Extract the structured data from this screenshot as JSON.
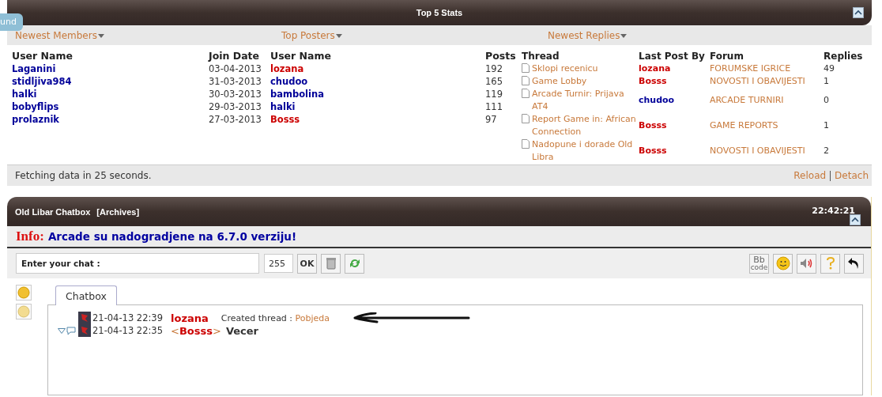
{
  "side_tab": "und",
  "stats": {
    "title": "Top 5 Stats",
    "tabs": [
      {
        "label": "Newest Members"
      },
      {
        "label": "Top Posters"
      },
      {
        "label": "Newest Replies"
      }
    ],
    "members": {
      "columns": [
        "User Name",
        "Join Date"
      ],
      "rows": [
        {
          "name": "Laganini",
          "date": "03-04-2013",
          "color": "#000099"
        },
        {
          "name": "stidljiva984",
          "date": "31-03-2013",
          "color": "#000099"
        },
        {
          "name": "halki",
          "date": "30-03-2013",
          "color": "#000099"
        },
        {
          "name": "bobyflips",
          "date": "29-03-2013",
          "color": "#000099"
        },
        {
          "name": "prolaznik",
          "date": "27-03-2013",
          "color": "#000099"
        }
      ]
    },
    "posters": {
      "columns": [
        "User Name",
        "Posts"
      ],
      "rows": [
        {
          "name": "lozana",
          "posts": "192",
          "color": "#cc0000"
        },
        {
          "name": "chudoo",
          "posts": "165",
          "color": "#000099"
        },
        {
          "name": "bambolina",
          "posts": "119",
          "color": "#000099"
        },
        {
          "name": "halki",
          "posts": "111",
          "color": "#000099"
        },
        {
          "name": "Bosss",
          "posts": "97",
          "color": "#cc0000"
        }
      ]
    },
    "replies": {
      "columns": [
        "Thread",
        "Last Post By",
        "Forum",
        "Replies"
      ],
      "rows": [
        {
          "thread": "Sklopi recenicu",
          "by": "lozana",
          "color": "#cc0000",
          "forum": "FORUMSKE IGRICE",
          "replies": "49"
        },
        {
          "thread": "Game Lobby",
          "by": "Bosss",
          "color": "#cc0000",
          "forum": "NOVOSTI I OBAVIJESTI",
          "replies": "1"
        },
        {
          "thread": "Arcade Turnir: Prijava AT4",
          "by": "chudoo",
          "color": "#000099",
          "forum": "ARCADE TURNIRI",
          "replies": "0"
        },
        {
          "thread": "Report Game in: African Connection",
          "by": "Bosss",
          "color": "#cc0000",
          "forum": "GAME REPORTS",
          "replies": "1"
        },
        {
          "thread": "Nadopune i dorade Old Libra",
          "by": "Bosss",
          "color": "#cc0000",
          "forum": "NOVOSTI I OBAVIJESTI",
          "replies": "2"
        }
      ]
    },
    "status": "Fetching data in 25 seconds.",
    "links": [
      "Reload",
      "Detach"
    ]
  },
  "chat": {
    "title": "Old Libar Chatbox",
    "archives": "[Archives]",
    "time": "22:42:21",
    "info_label": "Info:",
    "info_text": "Arcade su nadogradjene na 6.7.0 verziju!",
    "input_label": "Enter your chat :",
    "counter": "255",
    "ok": "OK",
    "bb": [
      "Bb",
      "code"
    ],
    "tab": "Chatbox",
    "messages": [
      {
        "kind": "event",
        "time": "21-04-13 22:39",
        "user": "lozana",
        "color": "#cc0000",
        "text": "Created thread : ",
        "link": "Pobjeda"
      },
      {
        "kind": "message",
        "time": "21-04-13 22:35",
        "open": "<",
        "user": "Bosss",
        "close": ">",
        "color": "#cc0000",
        "text": "Vecer"
      }
    ]
  }
}
